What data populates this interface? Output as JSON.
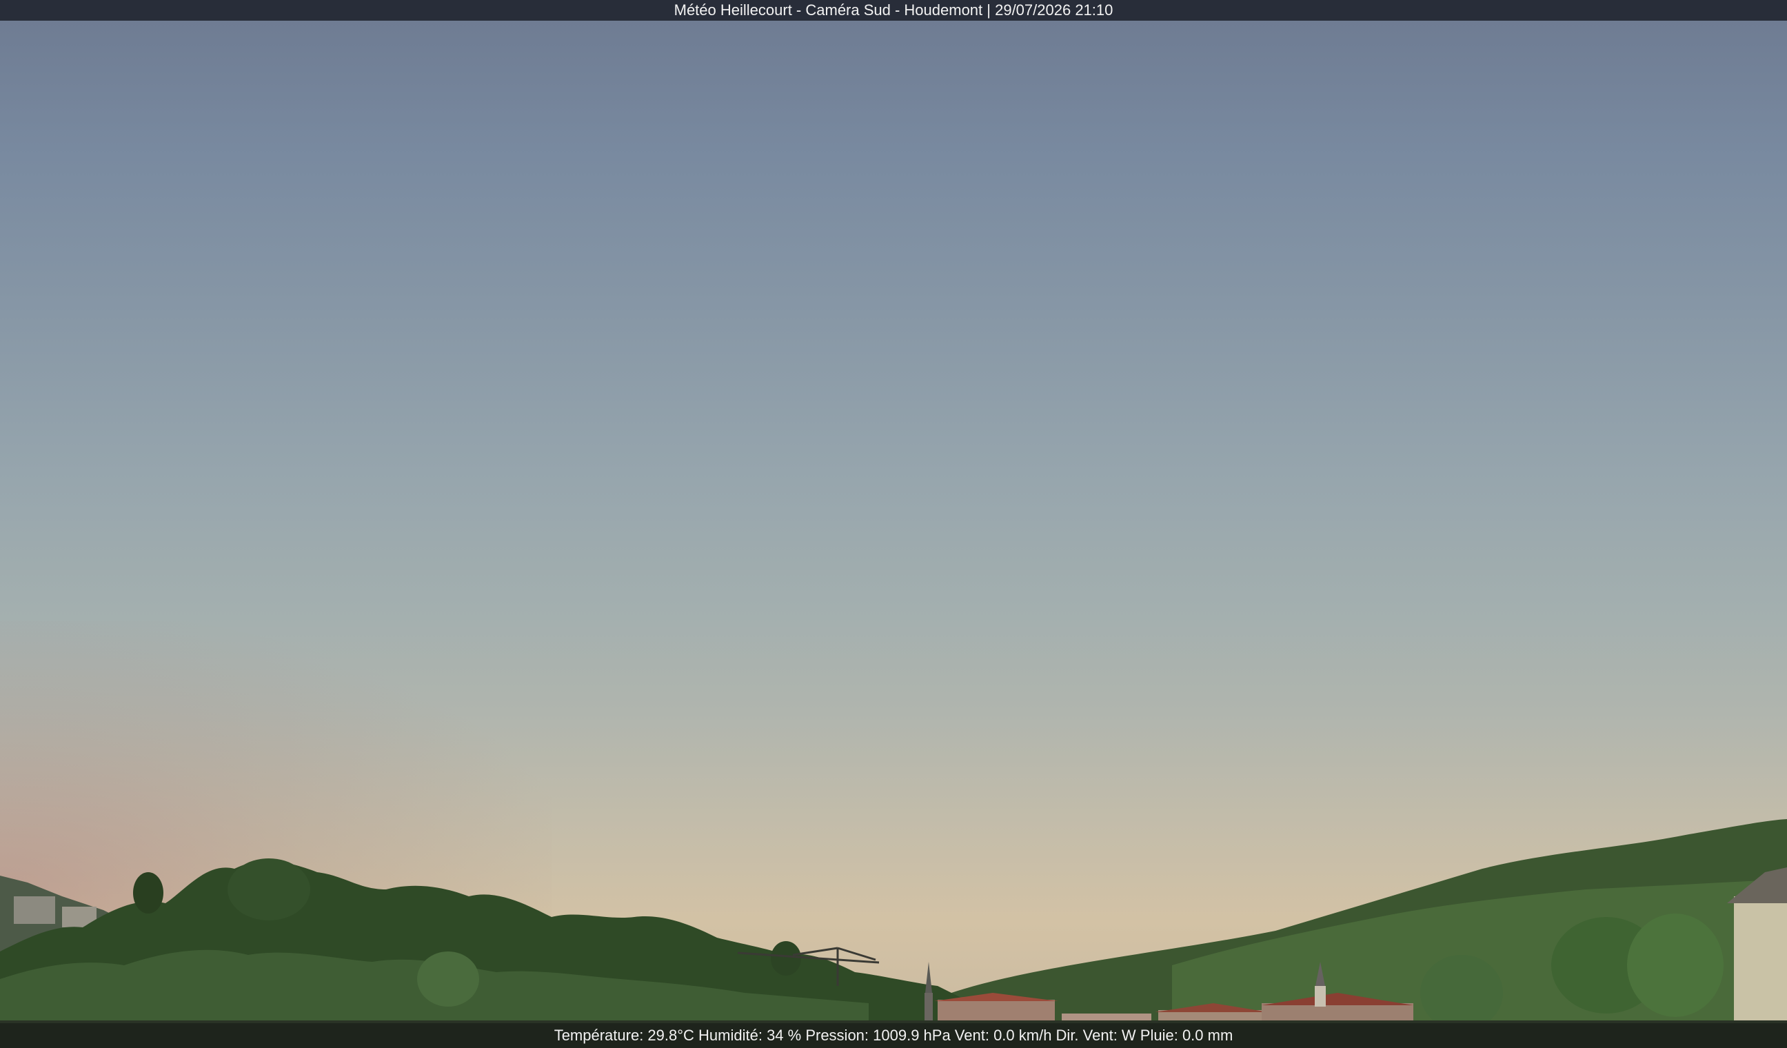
{
  "header": {
    "title": "Météo Heillecourt - Caméra Sud - Houdemont | 29/07/2026 21:10"
  },
  "footer": {
    "readings": "Température: 29.8°C  Humidité: 34 % Pression: 1009.9 hPa Vent: 0.0 km/h Dir. Vent: W Pluie: 0.0 mm"
  },
  "colors": {
    "sky_top": "#6d7a91",
    "sky_horizon": "#d3c2a5",
    "treeline": "#2f4a26",
    "bar_background": "#191c26",
    "bar_text": "#f2f2f2"
  }
}
